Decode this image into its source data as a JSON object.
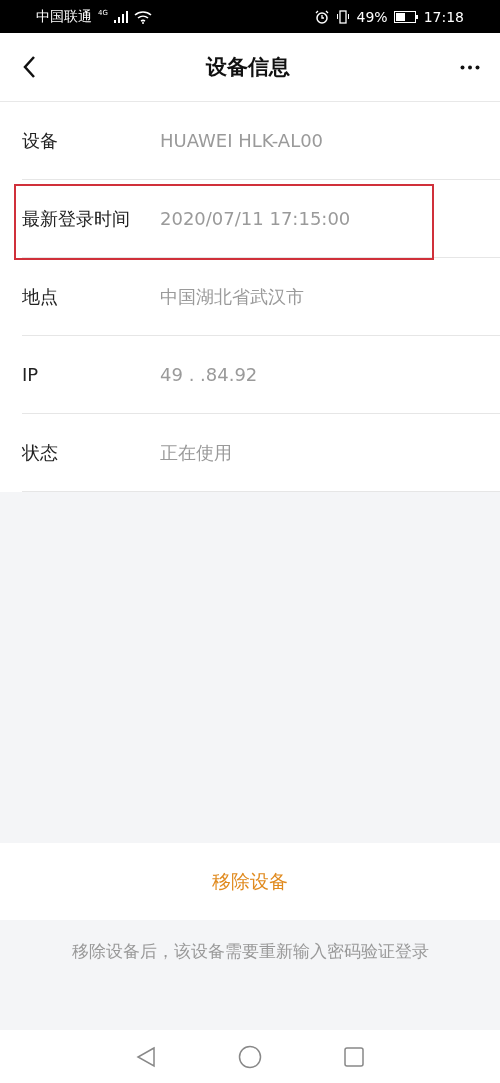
{
  "status_bar": {
    "carrier": "中国联通",
    "network": "4G",
    "battery": "49%",
    "time": "17:18"
  },
  "header": {
    "title": "设备信息"
  },
  "rows": [
    {
      "label": "设备",
      "value": "HUAWEI HLK-AL00",
      "highlighted": false
    },
    {
      "label": "最新登录时间",
      "value": "2020/07/11 17:15:00",
      "highlighted": true
    },
    {
      "label": "地点",
      "value": "中国湖北省武汉市",
      "highlighted": false
    },
    {
      "label": "IP",
      "value": "49 .  .84.92",
      "highlighted": false
    },
    {
      "label": "状态",
      "value": "正在使用",
      "highlighted": false
    }
  ],
  "remove_button": "移除设备",
  "hint": "移除设备后，该设备需要重新输入密码验证登录"
}
